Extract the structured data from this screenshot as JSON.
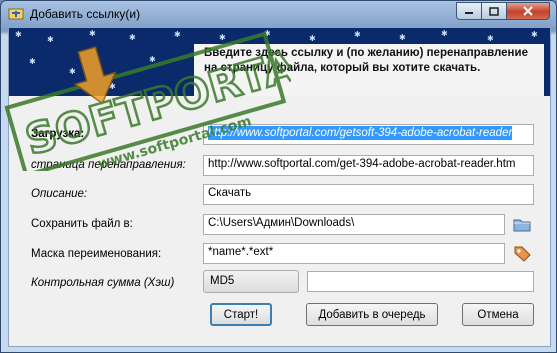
{
  "window": {
    "title": "Добавить ссылку(и)"
  },
  "header": {
    "text": "Введите здесь ссылку и (по желанию) перенаправление на страницу файла, который вы хотите скачать."
  },
  "form": {
    "download_label": "Загрузка:",
    "download_value": "http://www.softportal.com/getsoft-394-adobe-acrobat-reader",
    "redirect_label": "страница перенаправления:",
    "redirect_value": "http://www.softportal.com/get-394-adobe-acrobat-reader.htm",
    "description_label": "Описание:",
    "description_value": "Скачать",
    "save_label": "Сохранить файл в:",
    "save_value": "C:\\Users\\Админ\\Downloads\\",
    "mask_label": "Маска переименования:",
    "mask_value": "*name*.*ext*",
    "checksum_label": "Контрольная сумма (Хэш)",
    "checksum_type": "MD5",
    "checksum_value": ""
  },
  "buttons": {
    "start": "Старт!",
    "queue": "Добавить в очередь",
    "cancel": "Отмена"
  },
  "watermark": {
    "brand": "SOFTPORTAL",
    "url": "www.softportal.com"
  },
  "colors": {
    "header_bg": "#0a2a6b",
    "selection": "#3399ff",
    "watermark": "#3a7a2a"
  }
}
